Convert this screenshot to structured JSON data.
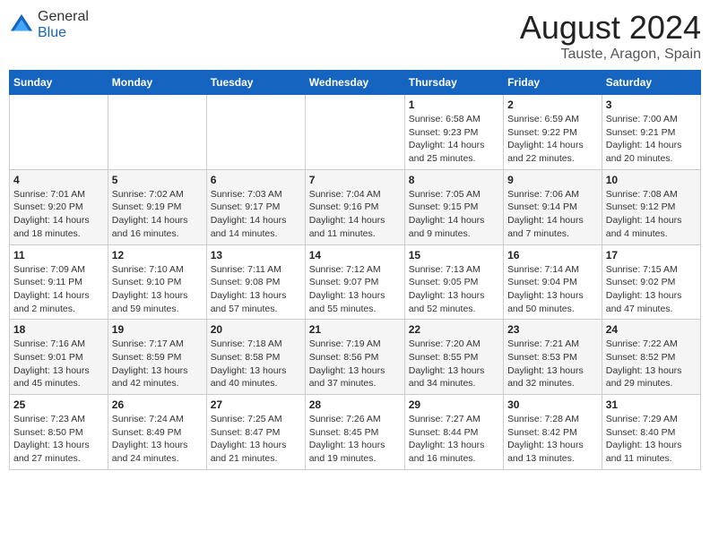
{
  "logo": {
    "general": "General",
    "blue": "Blue"
  },
  "header": {
    "month": "August 2024",
    "location": "Tauste, Aragon, Spain"
  },
  "days_of_week": [
    "Sunday",
    "Monday",
    "Tuesday",
    "Wednesday",
    "Thursday",
    "Friday",
    "Saturday"
  ],
  "weeks": [
    [
      {
        "day": "",
        "info": ""
      },
      {
        "day": "",
        "info": ""
      },
      {
        "day": "",
        "info": ""
      },
      {
        "day": "",
        "info": ""
      },
      {
        "day": "1",
        "info": "Sunrise: 6:58 AM\nSunset: 9:23 PM\nDaylight: 14 hours\nand 25 minutes."
      },
      {
        "day": "2",
        "info": "Sunrise: 6:59 AM\nSunset: 9:22 PM\nDaylight: 14 hours\nand 22 minutes."
      },
      {
        "day": "3",
        "info": "Sunrise: 7:00 AM\nSunset: 9:21 PM\nDaylight: 14 hours\nand 20 minutes."
      }
    ],
    [
      {
        "day": "4",
        "info": "Sunrise: 7:01 AM\nSunset: 9:20 PM\nDaylight: 14 hours\nand 18 minutes."
      },
      {
        "day": "5",
        "info": "Sunrise: 7:02 AM\nSunset: 9:19 PM\nDaylight: 14 hours\nand 16 minutes."
      },
      {
        "day": "6",
        "info": "Sunrise: 7:03 AM\nSunset: 9:17 PM\nDaylight: 14 hours\nand 14 minutes."
      },
      {
        "day": "7",
        "info": "Sunrise: 7:04 AM\nSunset: 9:16 PM\nDaylight: 14 hours\nand 11 minutes."
      },
      {
        "day": "8",
        "info": "Sunrise: 7:05 AM\nSunset: 9:15 PM\nDaylight: 14 hours\nand 9 minutes."
      },
      {
        "day": "9",
        "info": "Sunrise: 7:06 AM\nSunset: 9:14 PM\nDaylight: 14 hours\nand 7 minutes."
      },
      {
        "day": "10",
        "info": "Sunrise: 7:08 AM\nSunset: 9:12 PM\nDaylight: 14 hours\nand 4 minutes."
      }
    ],
    [
      {
        "day": "11",
        "info": "Sunrise: 7:09 AM\nSunset: 9:11 PM\nDaylight: 14 hours\nand 2 minutes."
      },
      {
        "day": "12",
        "info": "Sunrise: 7:10 AM\nSunset: 9:10 PM\nDaylight: 13 hours\nand 59 minutes."
      },
      {
        "day": "13",
        "info": "Sunrise: 7:11 AM\nSunset: 9:08 PM\nDaylight: 13 hours\nand 57 minutes."
      },
      {
        "day": "14",
        "info": "Sunrise: 7:12 AM\nSunset: 9:07 PM\nDaylight: 13 hours\nand 55 minutes."
      },
      {
        "day": "15",
        "info": "Sunrise: 7:13 AM\nSunset: 9:05 PM\nDaylight: 13 hours\nand 52 minutes."
      },
      {
        "day": "16",
        "info": "Sunrise: 7:14 AM\nSunset: 9:04 PM\nDaylight: 13 hours\nand 50 minutes."
      },
      {
        "day": "17",
        "info": "Sunrise: 7:15 AM\nSunset: 9:02 PM\nDaylight: 13 hours\nand 47 minutes."
      }
    ],
    [
      {
        "day": "18",
        "info": "Sunrise: 7:16 AM\nSunset: 9:01 PM\nDaylight: 13 hours\nand 45 minutes."
      },
      {
        "day": "19",
        "info": "Sunrise: 7:17 AM\nSunset: 8:59 PM\nDaylight: 13 hours\nand 42 minutes."
      },
      {
        "day": "20",
        "info": "Sunrise: 7:18 AM\nSunset: 8:58 PM\nDaylight: 13 hours\nand 40 minutes."
      },
      {
        "day": "21",
        "info": "Sunrise: 7:19 AM\nSunset: 8:56 PM\nDaylight: 13 hours\nand 37 minutes."
      },
      {
        "day": "22",
        "info": "Sunrise: 7:20 AM\nSunset: 8:55 PM\nDaylight: 13 hours\nand 34 minutes."
      },
      {
        "day": "23",
        "info": "Sunrise: 7:21 AM\nSunset: 8:53 PM\nDaylight: 13 hours\nand 32 minutes."
      },
      {
        "day": "24",
        "info": "Sunrise: 7:22 AM\nSunset: 8:52 PM\nDaylight: 13 hours\nand 29 minutes."
      }
    ],
    [
      {
        "day": "25",
        "info": "Sunrise: 7:23 AM\nSunset: 8:50 PM\nDaylight: 13 hours\nand 27 minutes."
      },
      {
        "day": "26",
        "info": "Sunrise: 7:24 AM\nSunset: 8:49 PM\nDaylight: 13 hours\nand 24 minutes."
      },
      {
        "day": "27",
        "info": "Sunrise: 7:25 AM\nSunset: 8:47 PM\nDaylight: 13 hours\nand 21 minutes."
      },
      {
        "day": "28",
        "info": "Sunrise: 7:26 AM\nSunset: 8:45 PM\nDaylight: 13 hours\nand 19 minutes."
      },
      {
        "day": "29",
        "info": "Sunrise: 7:27 AM\nSunset: 8:44 PM\nDaylight: 13 hours\nand 16 minutes."
      },
      {
        "day": "30",
        "info": "Sunrise: 7:28 AM\nSunset: 8:42 PM\nDaylight: 13 hours\nand 13 minutes."
      },
      {
        "day": "31",
        "info": "Sunrise: 7:29 AM\nSunset: 8:40 PM\nDaylight: 13 hours\nand 11 minutes."
      }
    ]
  ]
}
